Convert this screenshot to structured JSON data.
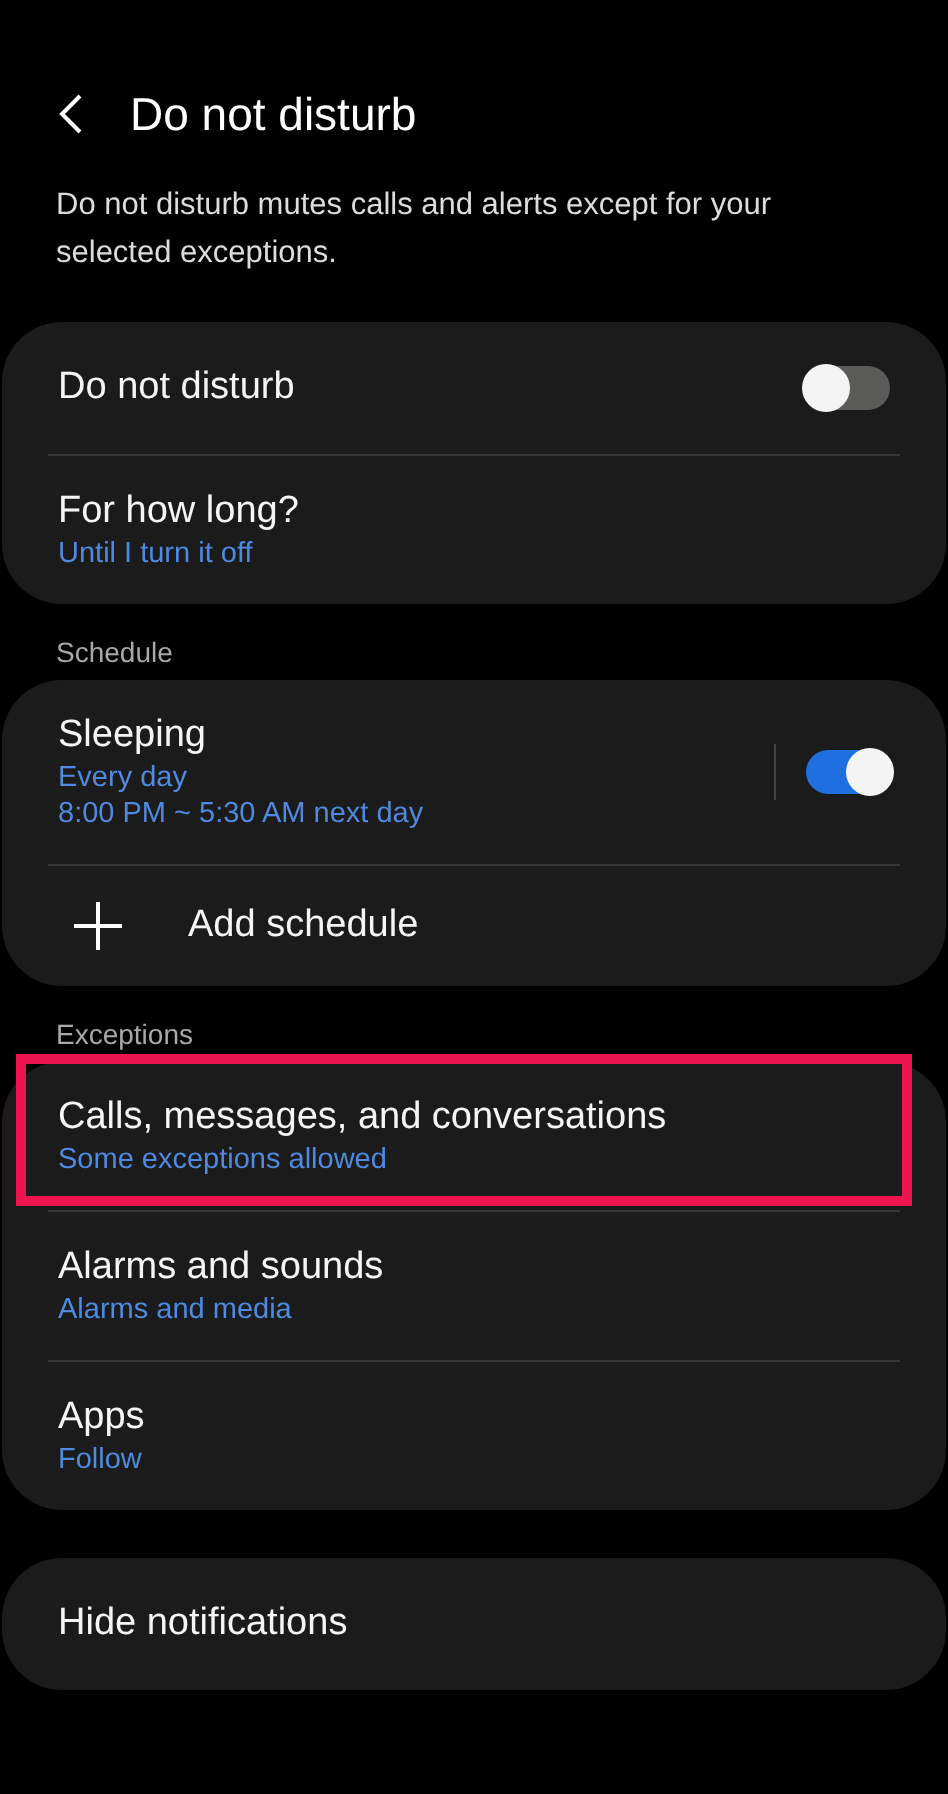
{
  "header": {
    "title": "Do not disturb"
  },
  "description": "Do not disturb mutes calls and alerts except for your selected exceptions.",
  "sections": [
    {
      "items": [
        {
          "kind": "toggle",
          "title": "Do not disturb",
          "on": false,
          "highlighted": false
        },
        {
          "kind": "text",
          "title": "For how long?",
          "subtitles": [
            "Until I turn it off"
          ],
          "highlighted": false
        }
      ]
    },
    {
      "header": "Schedule",
      "items": [
        {
          "kind": "toggle",
          "title": "Sleeping",
          "subtitles": [
            "Every day",
            "8:00 PM ~ 5:30 AM next day"
          ],
          "on": true,
          "highlighted": false
        },
        {
          "kind": "add",
          "title": "Add schedule",
          "highlighted": false
        }
      ]
    },
    {
      "header": "Exceptions",
      "items": [
        {
          "kind": "text",
          "title": "Calls, messages, and conversations",
          "subtitles": [
            "Some exceptions allowed"
          ],
          "highlighted": true
        },
        {
          "kind": "text",
          "title": "Alarms and sounds",
          "subtitles": [
            "Alarms and media"
          ],
          "highlighted": false
        },
        {
          "kind": "text",
          "title": "Apps",
          "subtitles": [
            "Follow"
          ],
          "highlighted": false
        }
      ]
    },
    {
      "items": [
        {
          "kind": "text",
          "title": "Hide notifications",
          "highlighted": false
        }
      ]
    }
  ]
}
